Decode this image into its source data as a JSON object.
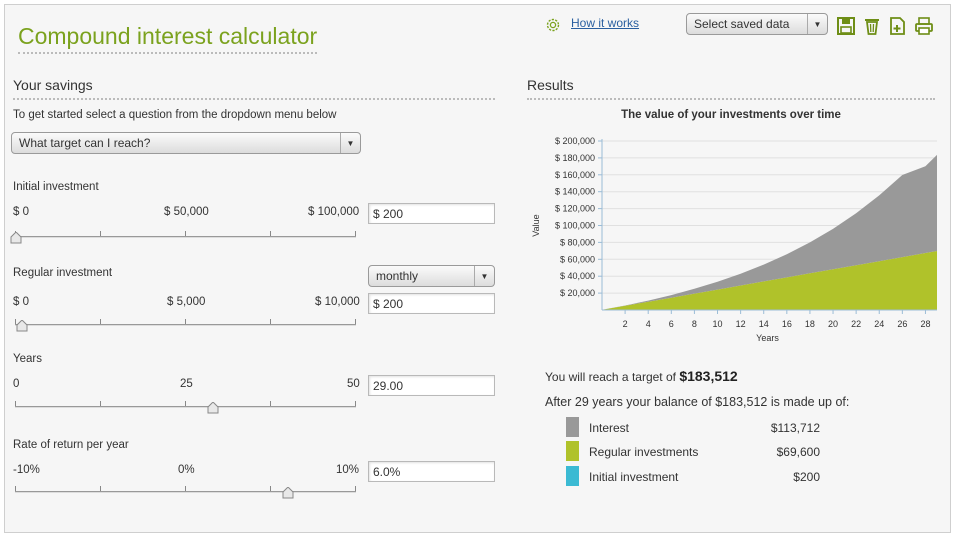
{
  "header": {
    "title": "Compound interest calculator",
    "how_it_works": "How it works",
    "saved_select": "Select saved data"
  },
  "savings": {
    "heading": "Your savings",
    "instructions": "To get started select a question from the dropdown menu below",
    "question": "What target can I reach?",
    "initial": {
      "label": "Initial investment",
      "min": "$ 0",
      "mid": "$ 50,000",
      "max": "$ 100,000",
      "value": "$ 200",
      "level_fraction": 0.002
    },
    "regular": {
      "label": "Regular investment",
      "min": "$ 0",
      "mid": "$ 5,000",
      "max": "$ 10,000",
      "value": "$ 200",
      "frequency": "monthly",
      "level_fraction": 0.02
    },
    "years": {
      "label": "Years",
      "min": "0",
      "mid": "25",
      "max": "50",
      "value": "29.00",
      "level_fraction": 0.58
    },
    "rate": {
      "label": "Rate of return per year",
      "min": "-10%",
      "mid": "0%",
      "max": "10%",
      "value": "6.0%",
      "level_fraction": 0.8
    }
  },
  "results": {
    "heading": "Results",
    "target_prefix": "You will reach a target of",
    "target_value": "$183,512",
    "made_up_text": "After 29 years your balance of $183,512 is made up of:",
    "breakdown": [
      {
        "name": "Interest",
        "value": "$113,712",
        "color": "#999999"
      },
      {
        "name": "Regular investments",
        "value": "$69,600",
        "color": "#b0c22a"
      },
      {
        "name": "Initial investment",
        "value": "$200",
        "color": "#3bbad3"
      }
    ]
  },
  "chart_data": {
    "type": "area",
    "title": "The value of your investments over time",
    "xlabel": "Years",
    "ylabel": "Value",
    "x_ticks": [
      2,
      4,
      6,
      8,
      10,
      12,
      14,
      16,
      18,
      20,
      22,
      24,
      26,
      28
    ],
    "y_ticks": [
      "$ 20,000",
      "$ 40,000",
      "$ 60,000",
      "$ 80,000",
      "$ 100,000",
      "$ 120,000",
      "$ 140,000",
      "$ 160,000",
      "$ 180,000",
      "$ 200,000"
    ],
    "ylim": [
      0,
      200000
    ],
    "xlim": [
      0,
      29
    ],
    "stacked": true,
    "grid": true,
    "x": [
      0,
      2,
      4,
      6,
      8,
      10,
      12,
      14,
      16,
      18,
      20,
      22,
      24,
      26,
      28,
      29
    ],
    "series": [
      {
        "name": "Initial investment",
        "color": "#3bbad3",
        "values": [
          200,
          200,
          200,
          200,
          200,
          200,
          200,
          200,
          200,
          200,
          200,
          200,
          200,
          200,
          200,
          200
        ]
      },
      {
        "name": "Regular investments",
        "color": "#b0c22a",
        "values": [
          0,
          4800,
          9600,
          14400,
          19200,
          24000,
          28800,
          33600,
          38400,
          43200,
          48000,
          52800,
          57600,
          62400,
          67200,
          69600
        ]
      },
      {
        "name": "Interest",
        "color": "#999999",
        "values": [
          0,
          300,
          1300,
          3000,
          5700,
          9200,
          13900,
          19900,
          27400,
          36600,
          47800,
          61500,
          77800,
          97200,
          102700,
          113712
        ]
      }
    ]
  }
}
